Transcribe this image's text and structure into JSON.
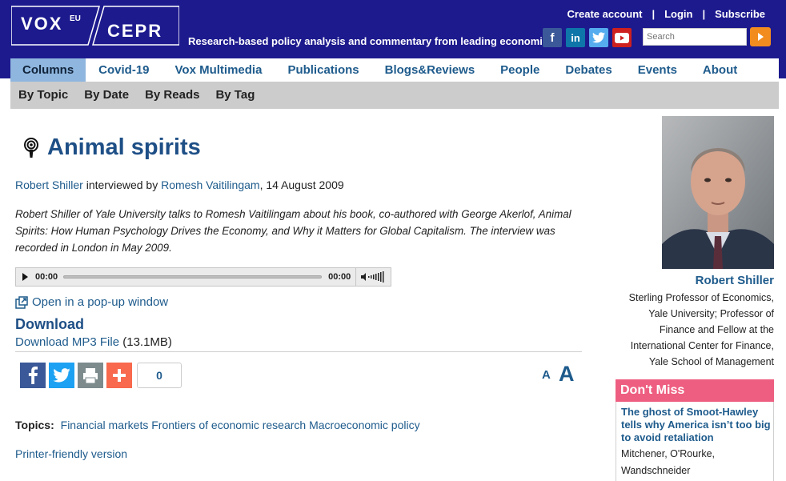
{
  "header": {
    "logo_vox": "VOX",
    "logo_eu": "EU",
    "logo_cepr": "CEPR",
    "tagline": "Research-based policy analysis and commentary from leading economists",
    "top_links": [
      "Create account",
      "Login",
      "Subscribe"
    ],
    "social": [
      "facebook-icon",
      "linkedin-icon",
      "twitter-icon",
      "youtube-icon"
    ],
    "search_placeholder": "Search"
  },
  "nav": {
    "main": [
      "Columns",
      "Covid-19",
      "Vox Multimedia",
      "Publications",
      "Blogs&Reviews",
      "People",
      "Debates",
      "Events",
      "About"
    ],
    "active": "Columns",
    "sub": [
      "By Topic",
      "By Date",
      "By Reads",
      "By Tag"
    ]
  },
  "article": {
    "title": "Animal spirits",
    "author": "Robert Shiller",
    "byline_mid": " interviewed by ",
    "interviewer": "Romesh Vaitilingam",
    "date": ", 14 August 2009",
    "summary": "Robert Shiller of Yale University talks to Romesh Vaitilingam about his book, co-authored with George Akerlof, Animal Spirits: How Human Psychology Drives the Economy, and Why it Matters for Global Capitalism. The interview was recorded in London in May 2009.",
    "player": {
      "time_start": "00:00",
      "time_end": "00:00"
    },
    "popup_link": "Open in a pop-up window",
    "download_heading": "Download",
    "download_link": "Download MP3 File",
    "download_size": " (13.1MB)",
    "share_count": "0",
    "font_small": "A",
    "font_large": "A",
    "topics_label": "Topics:",
    "topics": [
      "Financial markets",
      "Frontiers of economic research",
      "Macroeconomic policy"
    ],
    "printer_link": "Printer-friendly version"
  },
  "sidebar": {
    "author_name": "Robert Shiller",
    "author_bio": "Sterling Professor of Economics, Yale University; Professor of Finance and Fellow at the International Center for Finance, Yale School of Management",
    "dont_miss_title": "Don't Miss",
    "dont_miss_headline": "The ghost of Smoot-Hawley tells why America isn’t too big to avoid retaliation",
    "dont_miss_authors": "Mitchener, O'Rourke, Wandschneider"
  },
  "colors": {
    "header_bg": "#1d1a8e",
    "link": "#1e5b8c",
    "title": "#1e4f86",
    "dont_miss": "#ee5e80",
    "search_button": "#f28c1e"
  }
}
